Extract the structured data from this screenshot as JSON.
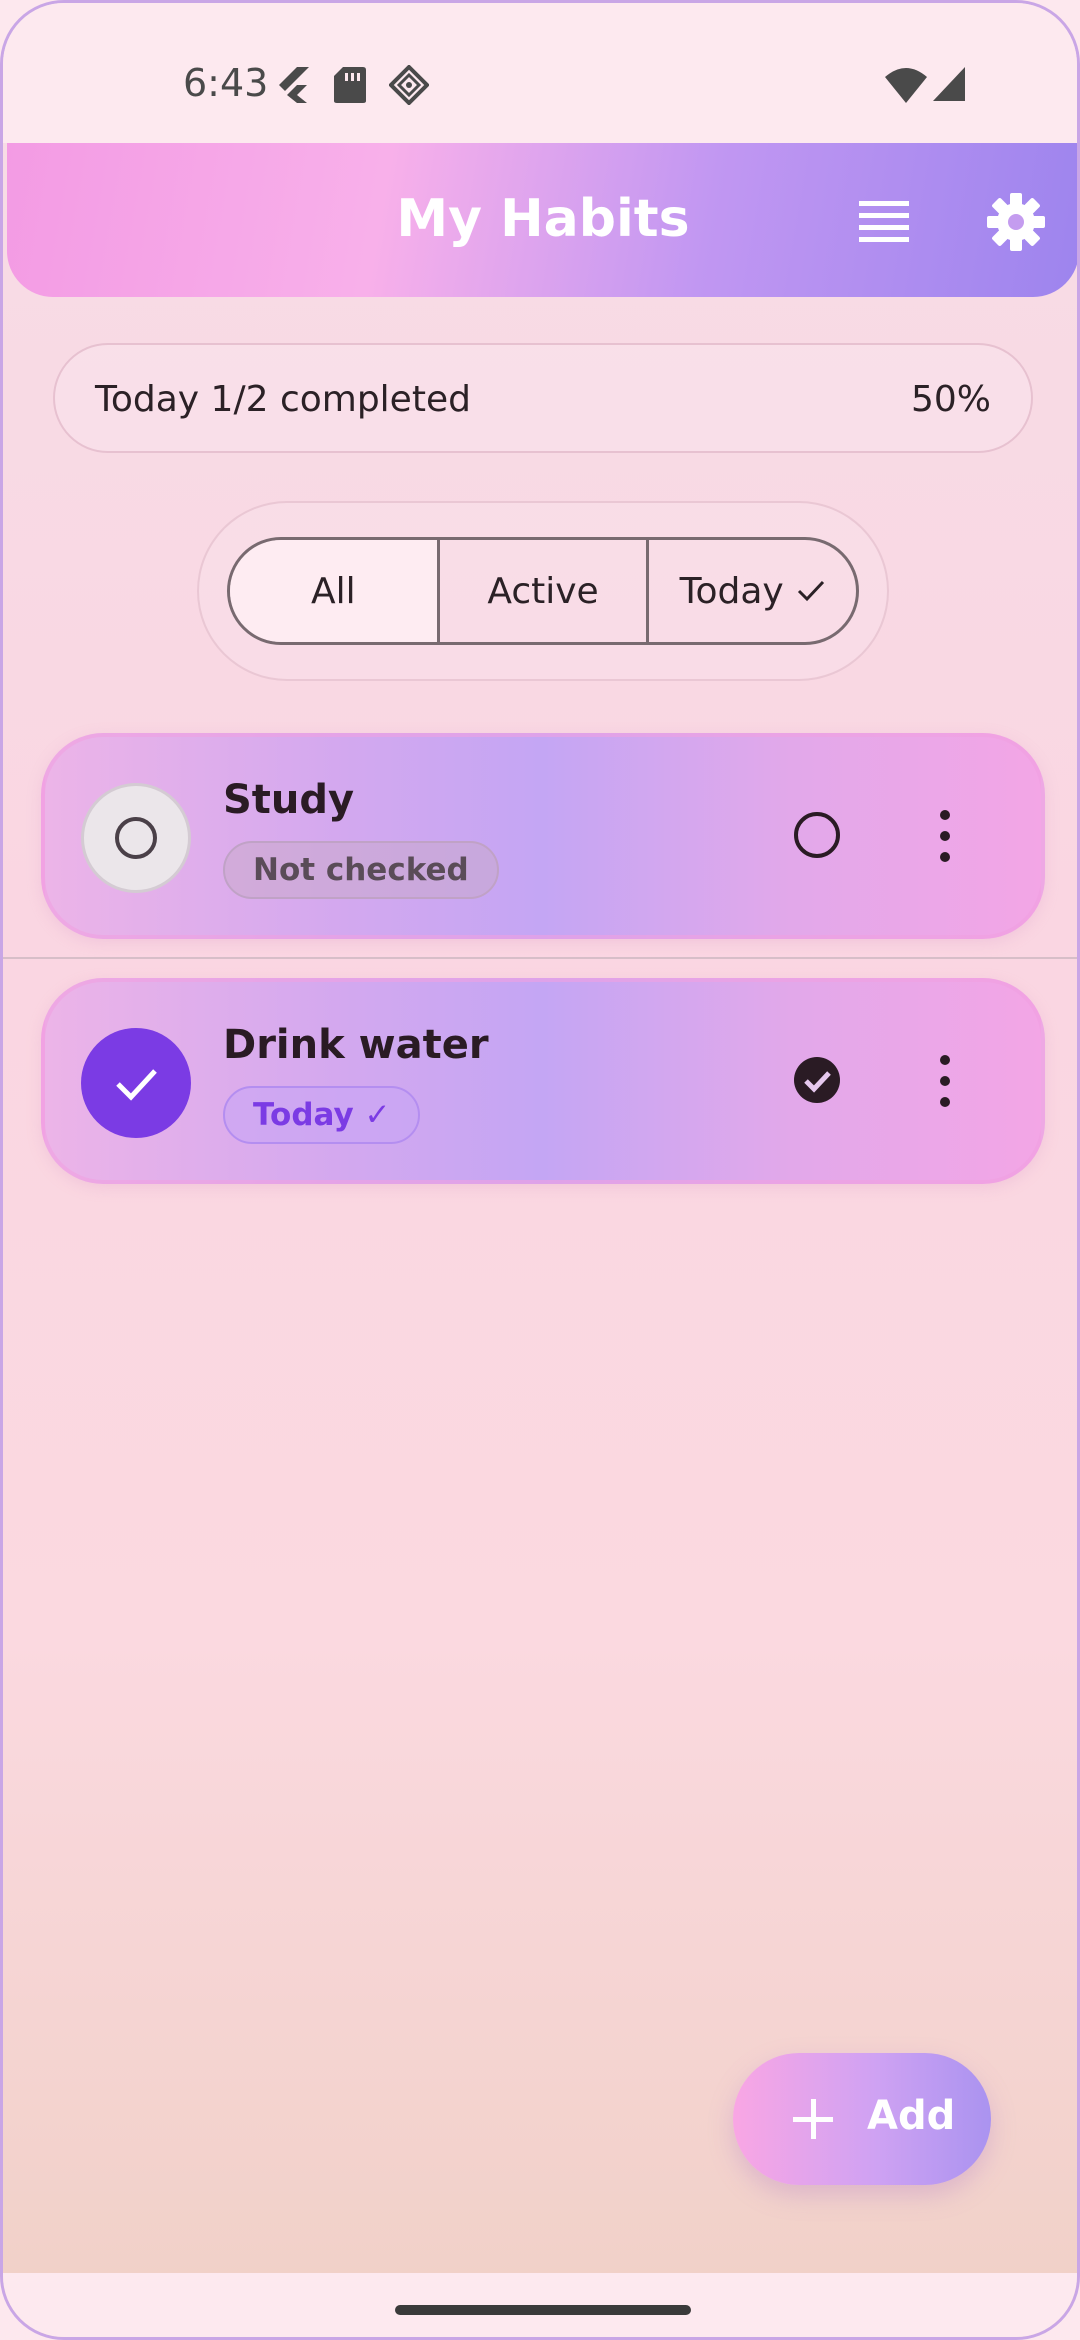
{
  "status_bar": {
    "time": "6:43",
    "left_icons": [
      "flutter-icon",
      "sd-card-icon",
      "debug-icon"
    ],
    "right_icons": [
      "wifi-icon",
      "cell-signal-icon"
    ]
  },
  "header": {
    "title": "My Habits",
    "actions": [
      "list-view-icon",
      "settings-icon"
    ],
    "colors": {
      "start": "#f39be4",
      "end": "#9d84ee"
    }
  },
  "summary": {
    "text": "Today 1/2 completed",
    "percent": "50%"
  },
  "filters": {
    "options": [
      {
        "label": "All",
        "selected": true
      },
      {
        "label": "Active",
        "selected": false
      },
      {
        "label": "Today",
        "selected": false
      }
    ]
  },
  "habits": [
    {
      "title": "Study",
      "badge": "Not checked",
      "checked": false
    },
    {
      "title": "Drink water",
      "badge": "Today ✓",
      "checked": true
    }
  ],
  "fab": {
    "label": "Add",
    "icon": "plus-icon"
  },
  "accent_color": "#7b3be4"
}
